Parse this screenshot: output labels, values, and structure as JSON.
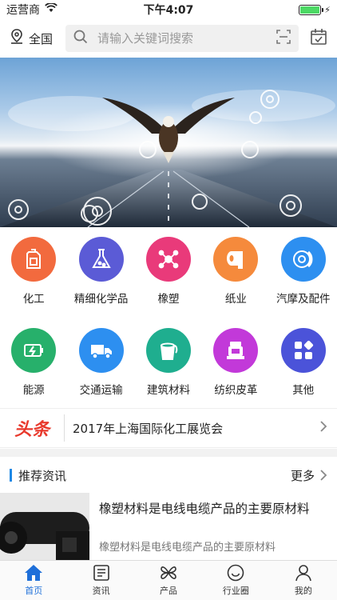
{
  "status_bar": {
    "carrier": "运营商",
    "time": "下午4:07",
    "battery_level": 1.0
  },
  "header": {
    "location": "全国",
    "search_placeholder": "请输入关键词搜索"
  },
  "categories": [
    {
      "label": "化工",
      "icon": "oil-jerrycan-icon",
      "color": "#f26a3e"
    },
    {
      "label": "精细化学品",
      "icon": "flask-icon",
      "color": "#5b5bd6"
    },
    {
      "label": "橡塑",
      "icon": "molecule-icon",
      "color": "#e93a7a"
    },
    {
      "label": "纸业",
      "icon": "paper-roll-icon",
      "color": "#f58a3c"
    },
    {
      "label": "汽摩及配件",
      "icon": "brake-disc-icon",
      "color": "#2d8ff0"
    },
    {
      "label": "能源",
      "icon": "battery-charge-icon",
      "color": "#27b06b"
    },
    {
      "label": "交通运输",
      "icon": "truck-icon",
      "color": "#2d8ff0"
    },
    {
      "label": "建筑材料",
      "icon": "paint-bucket-icon",
      "color": "#1fae8f"
    },
    {
      "label": "纺织皮革",
      "icon": "sewing-machine-icon",
      "color": "#c239d9"
    },
    {
      "label": "其他",
      "icon": "grid-icon",
      "color": "#4b53d9"
    }
  ],
  "headline": {
    "logo": "头条",
    "text": "2017年上海国际化工展览会"
  },
  "recommend": {
    "title": "推荐资讯",
    "more": "更多"
  },
  "articles": [
    {
      "title": "橡塑材料是电线电缆产品的主要原材料",
      "summary": "橡塑材料是电线电缆产品的主要原材料"
    }
  ],
  "tabs": [
    {
      "label": "首页",
      "icon": "home-icon",
      "active": true
    },
    {
      "label": "资讯",
      "icon": "news-icon"
    },
    {
      "label": "产品",
      "icon": "product-icon"
    },
    {
      "label": "行业圈",
      "icon": "smiley-icon"
    },
    {
      "label": "我的",
      "icon": "user-icon"
    }
  ]
}
